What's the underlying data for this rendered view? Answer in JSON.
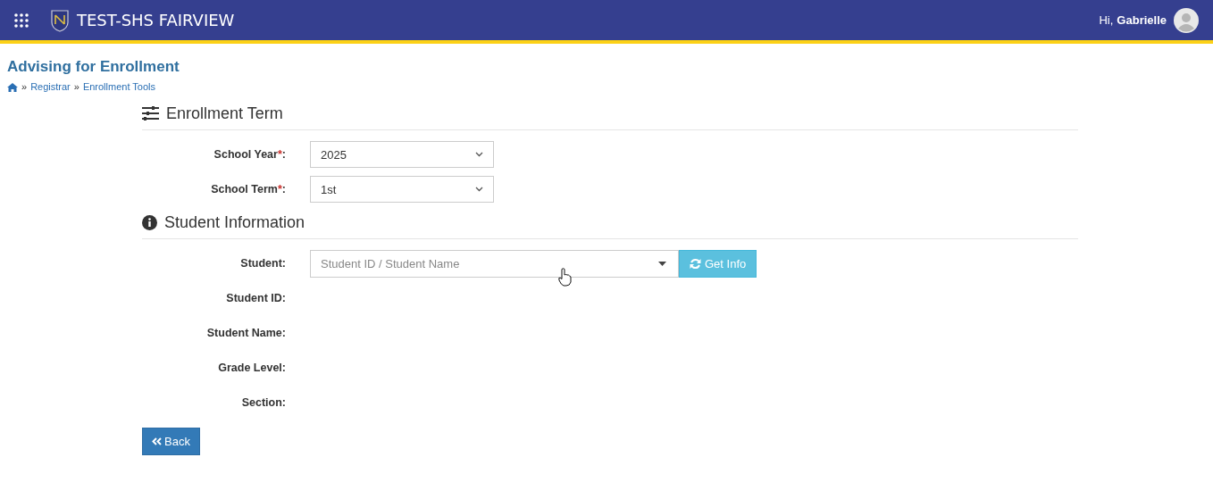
{
  "navbar": {
    "brand": "TEST-SHS FAIRVIEW",
    "greeting": "Hi,",
    "user": "Gabrielle"
  },
  "page_title": "Advising for Enrollment",
  "breadcrumb": [
    {
      "label": "Registrar",
      "separator": "»"
    },
    {
      "label": "Enrollment Tools",
      "separator": "»"
    }
  ],
  "sections": [
    {
      "title": "Enrollment Term",
      "fields": [
        {
          "kind": "select",
          "label": "School Year",
          "mark": "*",
          "colon": ":",
          "value": "2025"
        },
        {
          "kind": "select",
          "label": "School Term",
          "mark": "*",
          "colon": ":",
          "value": "1st"
        }
      ]
    },
    {
      "title": "Student Information",
      "fields": [
        {
          "kind": "combo",
          "label": "Student",
          "colon": ":",
          "placeholder": "Student ID / Student Name",
          "button": "Get Info"
        },
        {
          "kind": "static",
          "label": "Student ID",
          "colon": ":"
        },
        {
          "kind": "static",
          "label": "Student Name",
          "colon": ":"
        },
        {
          "kind": "static",
          "label": "Grade Level",
          "colon": ":"
        },
        {
          "kind": "static",
          "label": "Section",
          "colon": ":"
        }
      ]
    }
  ],
  "back_button": "Back"
}
